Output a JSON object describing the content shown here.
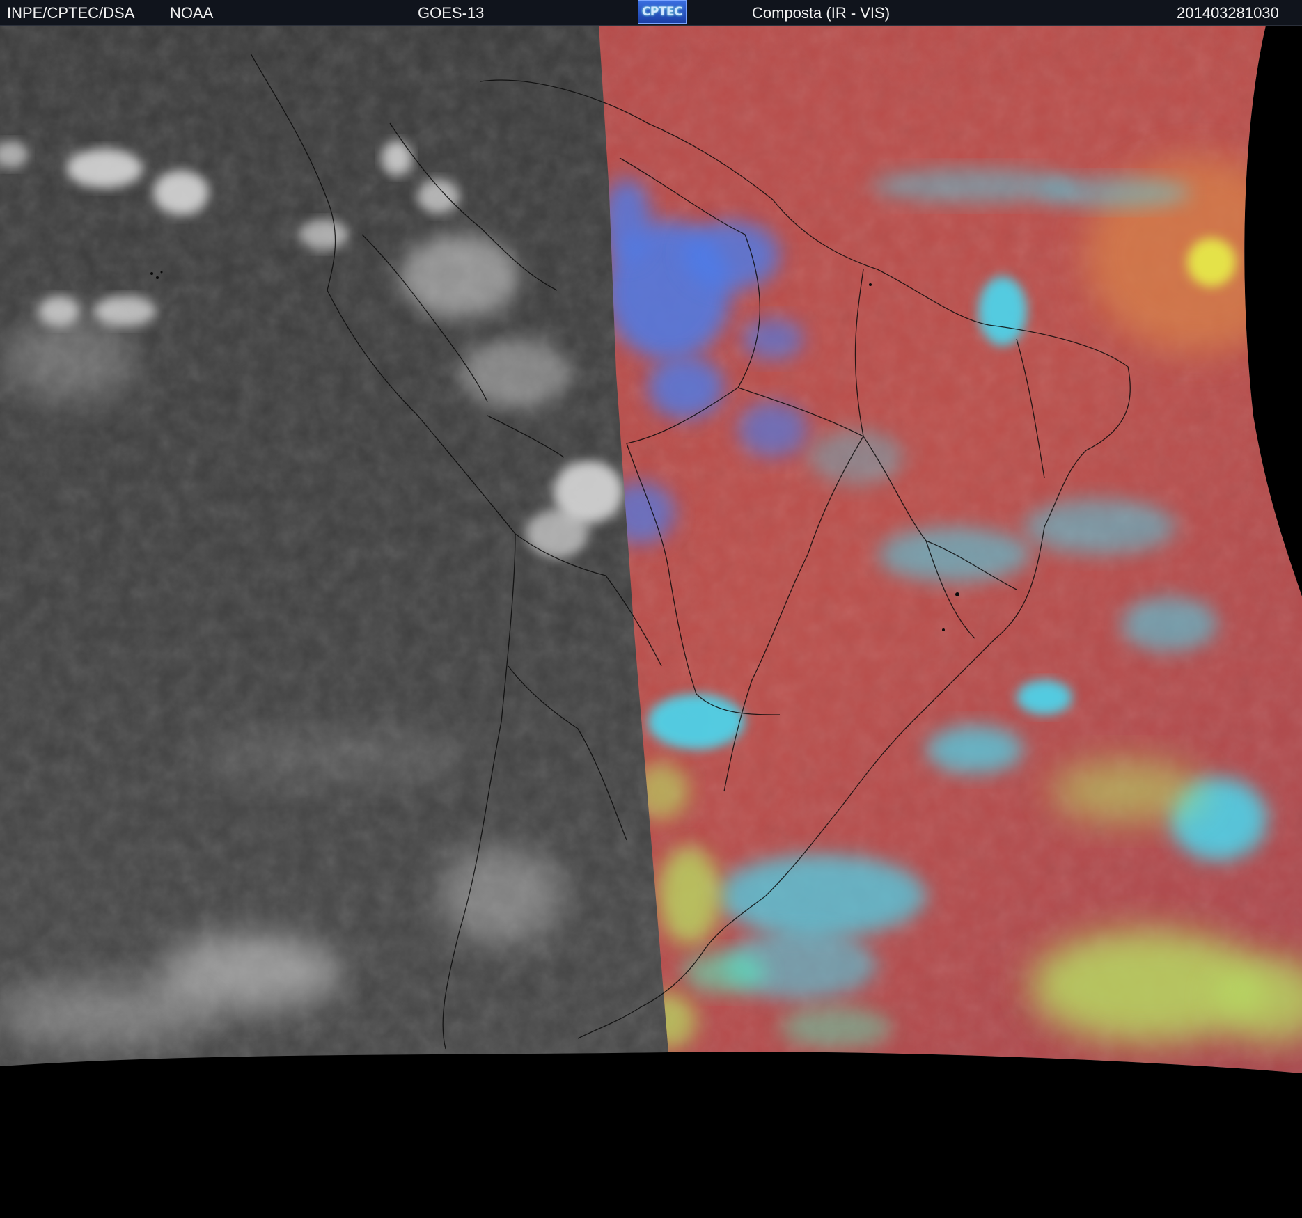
{
  "header": {
    "agency": "INPE/CPTEC/DSA",
    "source": "NOAA",
    "satellite": "GOES-13",
    "logo_text": "CPTEC",
    "product": "Composta (IR - VIS)",
    "timestamp": "201403281030"
  },
  "colors": {
    "header_bg": "#10141c",
    "ir_gray": "#3c3c3c",
    "composite_red": "#b84e4a",
    "cloud_cyan": "#49d8f0",
    "cloud_blue": "#4e7ce8",
    "cloud_green": "#b8e064",
    "space_black": "#000000"
  }
}
